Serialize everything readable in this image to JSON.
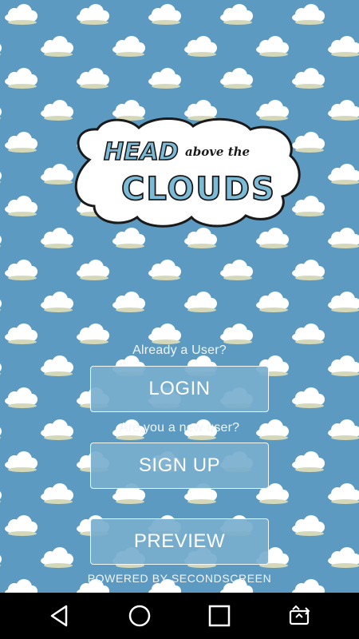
{
  "app": {
    "logo_line1": "HEAD",
    "logo_line1_small": "above the",
    "logo_line2": "CLOUDS"
  },
  "login_section": {
    "prompt": "Already a User?",
    "button_label": "LOGIN"
  },
  "signup_section": {
    "prompt": "Are you a new user?",
    "button_label": "SIGN UP"
  },
  "preview": {
    "button_label": "PREVIEW"
  },
  "footer": {
    "powered_by": "POWERED BY SECONDSCREEN"
  },
  "navbar": {
    "icons": [
      "back-icon",
      "home-icon",
      "recents-icon",
      "screen-rotate-icon"
    ]
  },
  "colors": {
    "sky": "#5d9ac1",
    "button_fill": "#78aecd",
    "logo_text": "#7cbad6"
  }
}
